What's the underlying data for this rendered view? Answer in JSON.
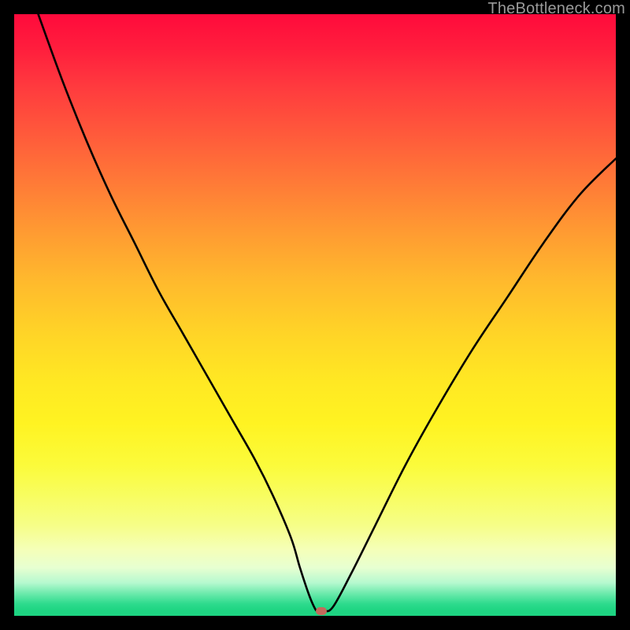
{
  "watermark": "TheBottleneck.com",
  "colors": {
    "frame_bg": "#000000",
    "curve_stroke": "#000000",
    "marker_fill": "#c36a5c",
    "watermark_text": "#9a9a9a",
    "gradient_top": "#ff0a3c",
    "gradient_bottom": "#1dd381"
  },
  "chart_data": {
    "type": "line",
    "title": "",
    "xlabel": "",
    "ylabel": "",
    "xlim": [
      0,
      100
    ],
    "ylim": [
      0,
      100
    ],
    "grid": false,
    "legend": false,
    "series": [
      {
        "name": "bottleneck-curve",
        "x": [
          4,
          8,
          12,
          16,
          20,
          24,
          28,
          32,
          36,
          40,
          43,
          46,
          47.5,
          49,
          50,
          50.5,
          51.5,
          53,
          56,
          60,
          65,
          70,
          76,
          82,
          88,
          94,
          100
        ],
        "values": [
          100,
          89,
          79,
          70,
          62,
          54,
          47,
          40,
          33,
          26,
          20,
          13,
          8,
          3.5,
          1.2,
          0.8,
          0.8,
          1.5,
          7,
          15,
          25,
          34,
          44,
          53,
          62,
          70,
          76
        ]
      }
    ],
    "marker": {
      "x": 51,
      "y": 0.8
    },
    "notes": "values are approximate percentages read from a tickless gradient plot; the curve drops from top-left, reaches ~0 near x≈50, then rises to the right"
  }
}
